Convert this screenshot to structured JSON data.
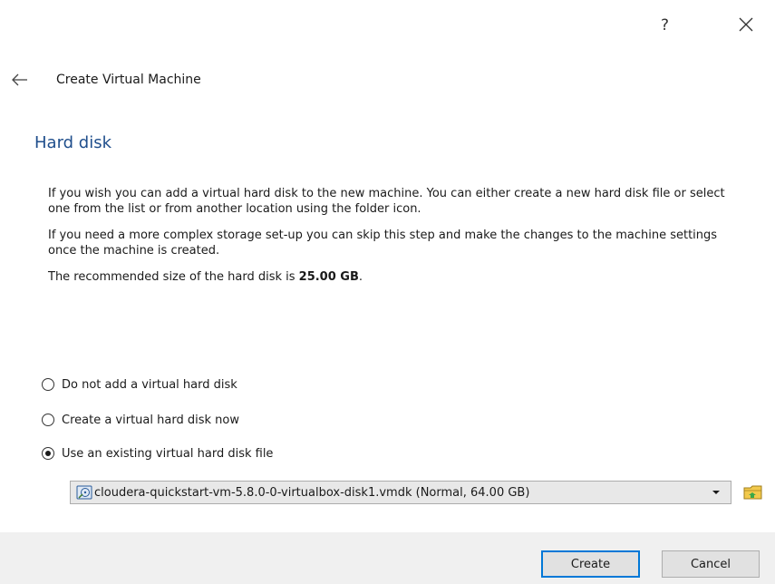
{
  "titlebar": {
    "help_label": "?",
    "close_icon": "close-icon"
  },
  "nav": {
    "back_icon": "back-arrow-icon",
    "wizard_title": "Create Virtual Machine"
  },
  "page": {
    "heading": "Hard disk",
    "para1": "If you wish you can add a virtual hard disk to the new machine. You can either create a new hard disk file or select one from the list or from another location using the folder icon.",
    "para2": "If you need a more complex storage set-up you can skip this step and make the changes to the machine settings once the machine is created.",
    "recommended_prefix": "The recommended size of the hard disk is ",
    "recommended_size": "25.00 GB",
    "recommended_suffix": "."
  },
  "options": [
    {
      "label": "Do not add a virtual hard disk",
      "selected": false
    },
    {
      "label": "Create a virtual hard disk now",
      "selected": false
    },
    {
      "label": "Use an existing virtual hard disk file",
      "selected": true
    }
  ],
  "disk_select": {
    "value": "cloudera-quickstart-vm-5.8.0-0-virtualbox-disk1.vmdk (Normal, 64.00 GB)",
    "disk_icon": "hard-disk-icon",
    "folder_icon": "folder-icon"
  },
  "footer": {
    "create_label": "Create",
    "cancel_label": "Cancel"
  },
  "colors": {
    "heading": "#1f4e8c",
    "footer_bg": "#f0f0f0",
    "combo_bg": "#e8e8e8",
    "primary_border": "#0078d7"
  }
}
